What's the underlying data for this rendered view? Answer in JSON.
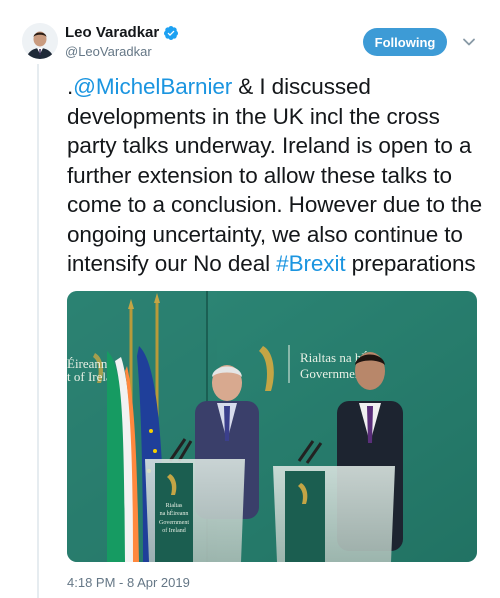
{
  "author": {
    "display_name": "Leo Varadkar",
    "handle": "@LeoVaradkar",
    "verified": true,
    "avatar_icon": "profile-avatar"
  },
  "actions": {
    "follow_label": "Following",
    "menu_icon": "chevron-down-icon"
  },
  "tweet": {
    "prefix": ".",
    "mention": "@MichelBarnier",
    "body": " & I discussed developments in the UK incl the cross party talks underway. Ireland is open to a further extension to allow these talks to come to a conclusion. However due to the ongoing uncertainty, we also continue to intensify our No deal ",
    "hashtag": "#Brexit",
    "suffix": " preparations",
    "timestamp": "4:18 PM - 8 Apr 2019"
  },
  "photo": {
    "sign_left_line1": "Éireann",
    "sign_left_line2": "t of Ireland",
    "sign_right_line1": "Rialtas na hÉi",
    "sign_right_line2": "Government",
    "podium_line1": "Rialtas",
    "podium_line2": "na hÉireann",
    "podium_line3": "Government",
    "podium_line4": "of Ireland"
  },
  "colors": {
    "link": "#1b95e0",
    "follow_button": "#3d9bd6",
    "muted": "#657786"
  }
}
